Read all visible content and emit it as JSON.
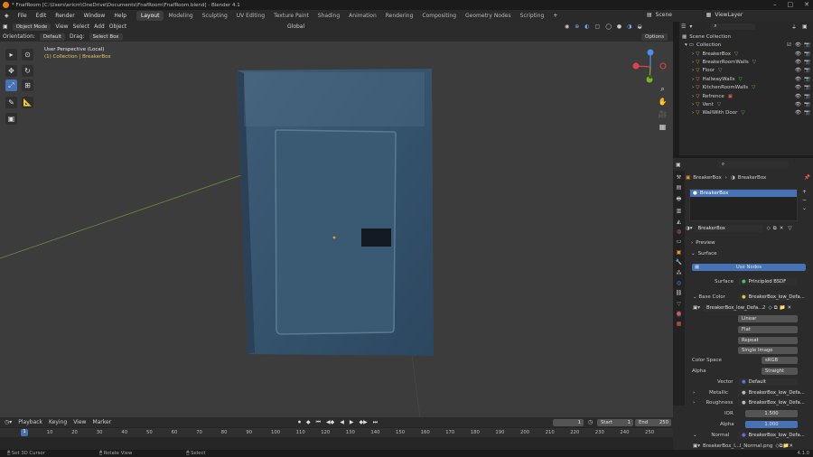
{
  "title_bar": {
    "title": "* FnafRoom [C:\\Users\\ericm\\OneDrive\\Documents\\FnafRoom\\FnafRoom.blend] - Blender 4.1"
  },
  "menu": [
    "File",
    "Edit",
    "Render",
    "Window",
    "Help"
  ],
  "workspaces": [
    "Layout",
    "Modeling",
    "Sculpting",
    "UV Editing",
    "Texture Paint",
    "Shading",
    "Animation",
    "Rendering",
    "Compositing",
    "Geometry Nodes",
    "Scripting"
  ],
  "active_workspace": "Layout",
  "top_right": {
    "scene": "Scene",
    "view_layer": "ViewLayer"
  },
  "viewport": {
    "mode": "Object Mode",
    "menu": [
      "View",
      "Select",
      "Add",
      "Object"
    ],
    "orientation_label": "Orientation:",
    "orientation_value": "Default",
    "drag_label": "Drag:",
    "drag_value": "Select Box",
    "transform_orientation": "Global",
    "options": "Options",
    "perspective": "User Perspective (Local)",
    "collection_path": "(1) Collection | BreakerBox",
    "gizmo": {
      "x": "X",
      "y": "Y",
      "z": "Z"
    }
  },
  "outliner": {
    "search_placeholder": "",
    "scene_collection": "Scene Collection",
    "collection": "Collection",
    "items": [
      "BreakerBox",
      "BreakerRoomWalls",
      "Floor",
      "HallwayWalls",
      "KitchenRoomWalls",
      "Refrence",
      "Vent",
      "WallWith Door"
    ]
  },
  "properties": {
    "search_placeholder": "",
    "breadcrumb_obj": "BreakerBox",
    "breadcrumb_mat": "BreakerBox",
    "slot": "BreakerBox",
    "material_name": "BreakerBox",
    "preview": "Preview",
    "surface_section": "Surface",
    "use_nodes": "Use Nodes",
    "surface_label": "Surface",
    "surface_value": "Principled BSDF",
    "base_color_label": "Base Color",
    "base_color_value": "BreakerBox_low_Defa...",
    "image_name": "BreakerBox_low_Defa...",
    "image_users": "2",
    "interp": "Linear",
    "projection": "Flat",
    "extension": "Repeat",
    "source": "Single Image",
    "color_space_label": "Color Space",
    "color_space_value": "sRGB",
    "alpha_label": "Alpha",
    "alpha_value": "Straight",
    "vector_label": "Vector",
    "vector_value": "Default",
    "metallic_label": "Metallic",
    "metallic_value": "BreakerBox_low_Defa...",
    "roughness_label": "Roughness",
    "roughness_value": "BreakerBox_low_Defa...",
    "ior_label": "IOR",
    "ior_value": "1.500",
    "alpha2_label": "Alpha",
    "alpha2_value": "1.000",
    "normal_label": "Normal",
    "normal_value": "BreakerBox_low_Defa...",
    "normal_image": "BreakerBox_l...l_Normal.png"
  },
  "timeline": {
    "menu": [
      "Playback",
      "Keying",
      "View",
      "Marker"
    ],
    "current_frame": "1",
    "start_label": "Start",
    "start": "1",
    "end_label": "End",
    "end": "250",
    "ticks": [
      "0",
      "10",
      "20",
      "30",
      "40",
      "50",
      "60",
      "70",
      "80",
      "90",
      "100",
      "110",
      "120",
      "130",
      "140",
      "150",
      "160",
      "170",
      "180",
      "190",
      "200",
      "210",
      "220",
      "230",
      "240",
      "250"
    ],
    "playhead": "1"
  },
  "status": {
    "left": "Set 3D Cursor",
    "middle": "Rotate View",
    "right": "Select",
    "version": "4.1.0"
  }
}
